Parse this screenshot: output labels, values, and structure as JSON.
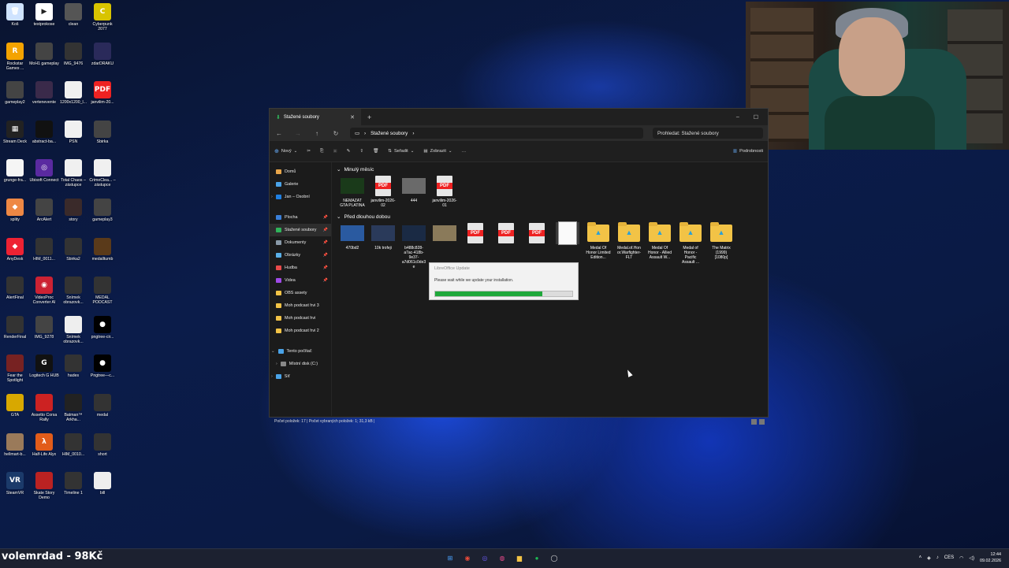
{
  "desktop_icons": [
    {
      "label": "Koš",
      "color": "#cfe3ff",
      "glyph": "🗑"
    },
    {
      "label": "testprokose",
      "color": "#ffffff",
      "glyph": "▶"
    },
    {
      "label": "clean",
      "color": "#555",
      "glyph": ""
    },
    {
      "label": "Cyberpunk 2077",
      "color": "#d8c400",
      "glyph": "C"
    },
    {
      "label": "Rockstar Games ...",
      "color": "#f4a300",
      "glyph": "R"
    },
    {
      "label": "MoH1 gameplay",
      "color": "#444",
      "glyph": ""
    },
    {
      "label": "IMG_9476",
      "color": "#333",
      "glyph": ""
    },
    {
      "label": "zdarDRAKU",
      "color": "#2a2a5a",
      "glyph": ""
    },
    {
      "label": "gameplay2",
      "color": "#444",
      "glyph": ""
    },
    {
      "label": "vertenevente",
      "color": "#3a2a4a",
      "glyph": ""
    },
    {
      "label": "1200x1200_l...",
      "color": "#f0f0f0",
      "glyph": ""
    },
    {
      "label": "janvilim-20...",
      "color": "#e22",
      "glyph": "PDF"
    },
    {
      "label": "Stream Deck",
      "color": "#222",
      "glyph": "▦"
    },
    {
      "label": "abstract-ba...",
      "color": "#111",
      "glyph": ""
    },
    {
      "label": "PSN",
      "color": "#f0f0f0",
      "glyph": ""
    },
    {
      "label": "Sbirka",
      "color": "#444",
      "glyph": ""
    },
    {
      "label": "grunge-fra...",
      "color": "#f5f5f5",
      "glyph": ""
    },
    {
      "label": "Ubisoft Connect",
      "color": "#5a2aa0",
      "glyph": "◎"
    },
    {
      "label": "Total Chaos – zástupce",
      "color": "#f0f0f0",
      "glyph": ""
    },
    {
      "label": "CrimeClea... – zástupce",
      "color": "#f0f0f0",
      "glyph": ""
    },
    {
      "label": "splity",
      "color": "#e84",
      "glyph": "◆"
    },
    {
      "label": "ArcAlert",
      "color": "#444",
      "glyph": ""
    },
    {
      "label": "story",
      "color": "#3a2a2a",
      "glyph": ""
    },
    {
      "label": "gameplay3",
      "color": "#444",
      "glyph": ""
    },
    {
      "label": "AnyDesk",
      "color": "#e23",
      "glyph": "◆"
    },
    {
      "label": "HIM_0011...",
      "color": "#333",
      "glyph": ""
    },
    {
      "label": "Sbirka2",
      "color": "#333",
      "glyph": ""
    },
    {
      "label": "medalltumb",
      "color": "#5a3a1a",
      "glyph": ""
    },
    {
      "label": "AlertFinal",
      "color": "#333",
      "glyph": ""
    },
    {
      "label": "VideoProc Converter AI",
      "color": "#c23",
      "glyph": "◉"
    },
    {
      "label": "Snímek obrazovk...",
      "color": "#333",
      "glyph": ""
    },
    {
      "label": "MEDAL PODCAST",
      "color": "#333",
      "glyph": ""
    },
    {
      "label": "RenderFinal",
      "color": "#333",
      "glyph": ""
    },
    {
      "label": "IMG_9278",
      "color": "#444",
      "glyph": ""
    },
    {
      "label": "Snímek obrazovk...",
      "color": "#eee",
      "glyph": ""
    },
    {
      "label": "pngtree-cir...",
      "color": "#000",
      "glyph": "●"
    },
    {
      "label": "Fear the Spotlight",
      "color": "#722",
      "glyph": ""
    },
    {
      "label": "Logitech G HUB",
      "color": "#111",
      "glyph": "G"
    },
    {
      "label": "hades",
      "color": "#333",
      "glyph": ""
    },
    {
      "label": "Pngtree—c...",
      "color": "#000",
      "glyph": "●"
    },
    {
      "label": "GTA",
      "color": "#d8a800",
      "glyph": ""
    },
    {
      "label": "Assetto Corsa Rally",
      "color": "#c22",
      "glyph": ""
    },
    {
      "label": "Batman™ Arkha...",
      "color": "#222",
      "glyph": ""
    },
    {
      "label": "medal",
      "color": "#333",
      "glyph": ""
    },
    {
      "label": "hellmart-b...",
      "color": "#9a7a5a",
      "glyph": ""
    },
    {
      "label": "Half-Life Alyx",
      "color": "#e25c1a",
      "glyph": "λ"
    },
    {
      "label": "HIM_0010...",
      "color": "#333",
      "glyph": ""
    },
    {
      "label": "short",
      "color": "#333",
      "glyph": ""
    },
    {
      "label": "SteamVR",
      "color": "#1b3a6a",
      "glyph": "VR"
    },
    {
      "label": "Skate Story Demo",
      "color": "#b22",
      "glyph": ""
    },
    {
      "label": "Timeline 1",
      "color": "#333",
      "glyph": ""
    },
    {
      "label": "bill",
      "color": "#eee",
      "glyph": ""
    }
  ],
  "explorer": {
    "tab_title": "Stažené soubory",
    "breadcrumb": "Stažené soubory",
    "search_placeholder": "Prohledat: Stažené soubory",
    "toolbar": {
      "new": "Nový",
      "sort": "Seřadit",
      "view": "Zobrazit",
      "more": "…",
      "details": "Podrobnosti"
    },
    "nav": [
      {
        "label": "Domů",
        "color": "#e8a64a",
        "pin": false
      },
      {
        "label": "Galerie",
        "color": "#4aa3e8",
        "pin": false
      },
      {
        "label": "Jan – Osobní",
        "color": "#1f7fe0",
        "pin": false,
        "expander": true
      },
      {
        "gap": true
      },
      {
        "label": "Plocha",
        "color": "#3a7fd8",
        "pin": true
      },
      {
        "label": "Stažené soubory",
        "color": "#2fb35a",
        "pin": true,
        "selected": true
      },
      {
        "label": "Dokumenty",
        "color": "#8a9aa8",
        "pin": true
      },
      {
        "label": "Obrázky",
        "color": "#5ab0e8",
        "pin": true
      },
      {
        "label": "Hudba",
        "color": "#e84a4a",
        "pin": true
      },
      {
        "label": "Videa",
        "color": "#a04ae8",
        "pin": true
      },
      {
        "label": "OBS assety",
        "color": "#f2c346",
        "pin": false
      },
      {
        "label": "Moh podcast hvi 3",
        "color": "#f2c346",
        "pin": false
      },
      {
        "label": "Moh podcast hvi",
        "color": "#f2c346",
        "pin": false
      },
      {
        "label": "Moh podcast hvi 2",
        "color": "#f2c346",
        "pin": false
      },
      {
        "gap": true
      },
      {
        "label": "Tento počítač",
        "color": "#4aa3e8",
        "pin": false,
        "expander": true
      },
      {
        "label": "Místní disk (C:)",
        "color": "#888",
        "pin": false,
        "expander": true,
        "indent": true
      },
      {
        "label": "Síť",
        "color": "#4aa3e8",
        "pin": false,
        "expander": true
      }
    ],
    "group1": {
      "title": "Minulý měsíc",
      "files": [
        {
          "name": "NEMAZAT GTA PLATINA",
          "kind": "img",
          "color": "#1a3a1a"
        },
        {
          "name": "janvilim-2026-02",
          "kind": "pdf"
        },
        {
          "name": "444",
          "kind": "img",
          "color": "#6a6a6a"
        },
        {
          "name": "janvilim-2026-01",
          "kind": "pdf"
        }
      ]
    },
    "group2": {
      "title": "Před dlouhou dobou",
      "files": [
        {
          "name": "470bd2",
          "kind": "img",
          "color": "#2a5aa0"
        },
        {
          "name": "10k trofeji",
          "kind": "img",
          "color": "#2a3a5a"
        },
        {
          "name": "b488c828-a7ac-418b-9e37-a7d061c0de3e",
          "kind": "img",
          "color": "#1a2a44"
        },
        {
          "name": "",
          "kind": "img",
          "color": "#8a7a5a"
        },
        {
          "name": "",
          "kind": "pdf"
        },
        {
          "name": "",
          "kind": "pdf"
        },
        {
          "name": "",
          "kind": "pdf"
        },
        {
          "name": "",
          "kind": "doc"
        },
        {
          "name": "Medal Of Honor Limited Edition...",
          "kind": "folder"
        },
        {
          "name": "Medal.of.Honor.Warfighter-FLT",
          "kind": "folder"
        },
        {
          "name": "Medal Of Honor - Allied Assault W...",
          "kind": "folder"
        },
        {
          "name": "Medal of Honor - Pacific Assault ...",
          "kind": "folder"
        },
        {
          "name": "The Matrix (1999) [1080p]",
          "kind": "folder"
        }
      ]
    },
    "status": "Počet položek: 17 | Počet vybraných položek: 1; 31,3 kB |"
  },
  "dialog": {
    "title": "LibreOffice Update",
    "message": "Please wait while we update your installation.",
    "progress": 0.78
  },
  "taskbar": {
    "ticker": "volemrdad - 98Kč",
    "apps": [
      {
        "name": "start",
        "glyph": "⊞",
        "color": "#4aa3ff"
      },
      {
        "name": "chrome",
        "glyph": "◉",
        "color": "#e84a3a"
      },
      {
        "name": "app2",
        "glyph": "◎",
        "color": "#6a5af0"
      },
      {
        "name": "app3",
        "glyph": "◍",
        "color": "#e84a8a"
      },
      {
        "name": "explorer",
        "glyph": "▆",
        "color": "#f2c346"
      },
      {
        "name": "spotify",
        "glyph": "●",
        "color": "#1db954"
      },
      {
        "name": "app6",
        "glyph": "◯",
        "color": "#ddd"
      }
    ],
    "lang": "CES",
    "time": "12:44",
    "date": "09.02.2026"
  }
}
